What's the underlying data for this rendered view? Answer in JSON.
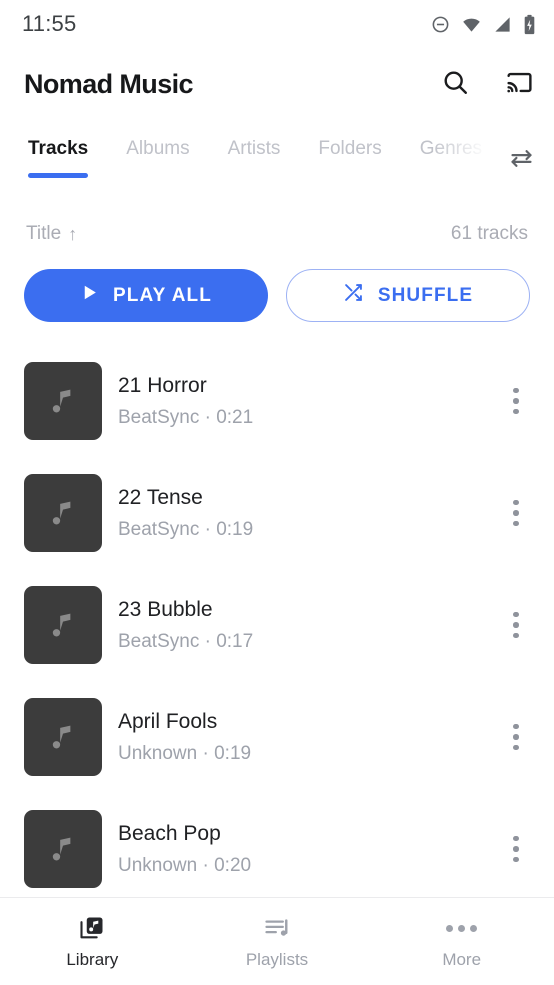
{
  "status_bar": {
    "time": "11:55",
    "icons": [
      "do-not-disturb-icon",
      "wifi-icon",
      "cell-signal-icon",
      "battery-charging-icon"
    ]
  },
  "app_bar": {
    "title": "Nomad Music",
    "search_icon": "search-icon",
    "cast_icon": "cast-icon"
  },
  "tabs": {
    "items": [
      {
        "label": "Tracks",
        "active": true
      },
      {
        "label": "Albums",
        "active": false
      },
      {
        "label": "Artists",
        "active": false
      },
      {
        "label": "Folders",
        "active": false
      },
      {
        "label": "Genres",
        "active": false
      }
    ],
    "swap_icon": "swap-horizontal-icon",
    "accent_color": "#3b6ef0"
  },
  "sort_row": {
    "sort_label": "Title",
    "sort_direction": "↑",
    "count_label": "61 tracks"
  },
  "actions": {
    "play_all_label": "PLAY ALL",
    "play_icon": "play-icon",
    "shuffle_label": "SHUFFLE",
    "shuffle_icon": "shuffle-icon",
    "primary_color": "#3b6ef0"
  },
  "tracks": [
    {
      "title": "21 Horror",
      "artist": "BeatSync",
      "duration": "0:21",
      "subtitle": "BeatSync · 0:21"
    },
    {
      "title": "22 Tense",
      "artist": "BeatSync",
      "duration": "0:19",
      "subtitle": "BeatSync · 0:19"
    },
    {
      "title": "23 Bubble",
      "artist": "BeatSync",
      "duration": "0:17",
      "subtitle": "BeatSync · 0:17"
    },
    {
      "title": "April Fools",
      "artist": "Unknown",
      "duration": "0:19",
      "subtitle": "Unknown · 0:19"
    },
    {
      "title": "Beach Pop",
      "artist": "Unknown",
      "duration": "0:20",
      "subtitle": "Unknown · 0:20"
    }
  ],
  "bottom_nav": {
    "items": [
      {
        "label": "Library",
        "icon": "library-music-icon",
        "active": true
      },
      {
        "label": "Playlists",
        "icon": "playlist-icon",
        "active": false
      },
      {
        "label": "More",
        "icon": "more-horizontal-icon",
        "active": false
      }
    ]
  }
}
